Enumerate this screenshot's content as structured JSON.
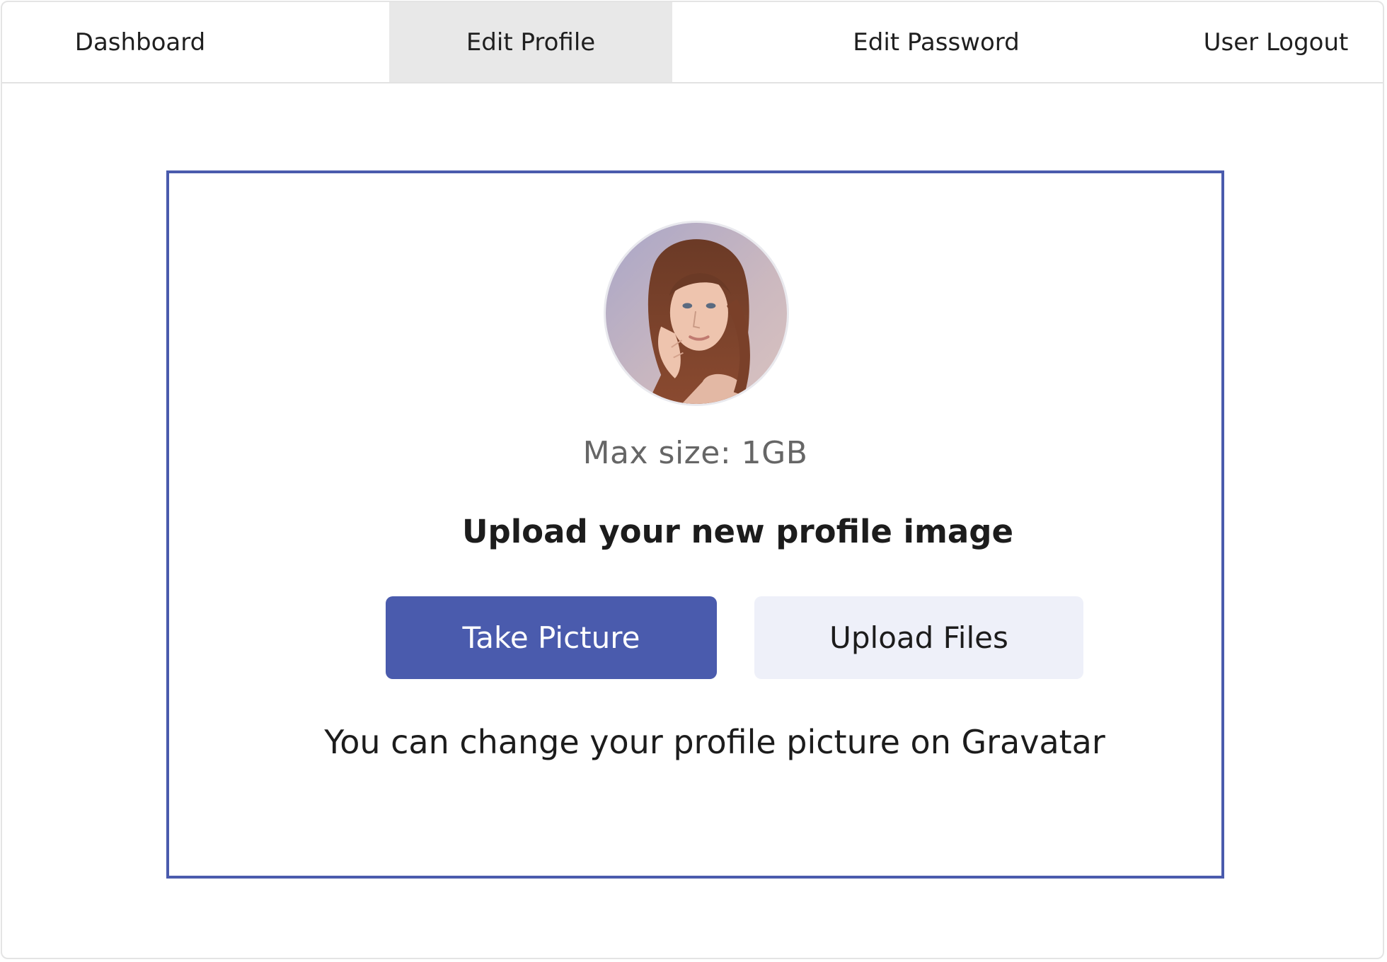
{
  "nav": {
    "tabs": [
      {
        "label": "Dashboard",
        "active": false
      },
      {
        "label": "Edit Profile",
        "active": true
      },
      {
        "label": "Edit Password",
        "active": false
      },
      {
        "label": "User Logout",
        "active": false
      }
    ]
  },
  "profile": {
    "avatar_icon": "profile-photo",
    "max_size": "Max size: 1GB",
    "heading": "Upload your new profile image",
    "take_picture_label": "Take Picture",
    "upload_files_label": "Upload Files",
    "gravatar_note": "You can change your profile picture on Gravatar"
  },
  "colors": {
    "accent": "#4a5bad",
    "secondary_button_bg": "#eef0f9",
    "active_tab_bg": "#e8e8e8"
  }
}
